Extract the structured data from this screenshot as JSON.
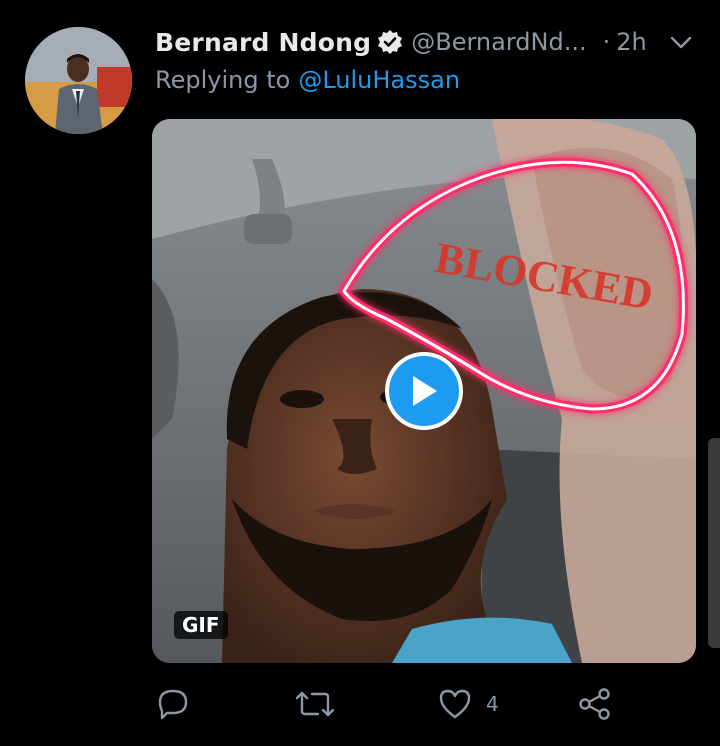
{
  "tweet": {
    "author": {
      "name": "Bernard Ndong",
      "handle": "@BernardNd...",
      "verified": true
    },
    "separator": "·",
    "time": "2h",
    "reply_prefix": "Replying to",
    "reply_to": "@LuluHassan",
    "media": {
      "badge": "GIF",
      "overlay_text": "BLOCKED",
      "play_icon": "play-icon"
    },
    "actions": {
      "reply_icon": "reply-icon",
      "retweet_icon": "retweet-icon",
      "like_icon": "heart-icon",
      "like_count": "4",
      "share_icon": "share-icon"
    }
  },
  "colors": {
    "background": "#000000",
    "name": "#e7e9ea",
    "secondary": "#8b98a5",
    "accent": "#1d9bf0",
    "highlight": "#ff2d6a"
  }
}
